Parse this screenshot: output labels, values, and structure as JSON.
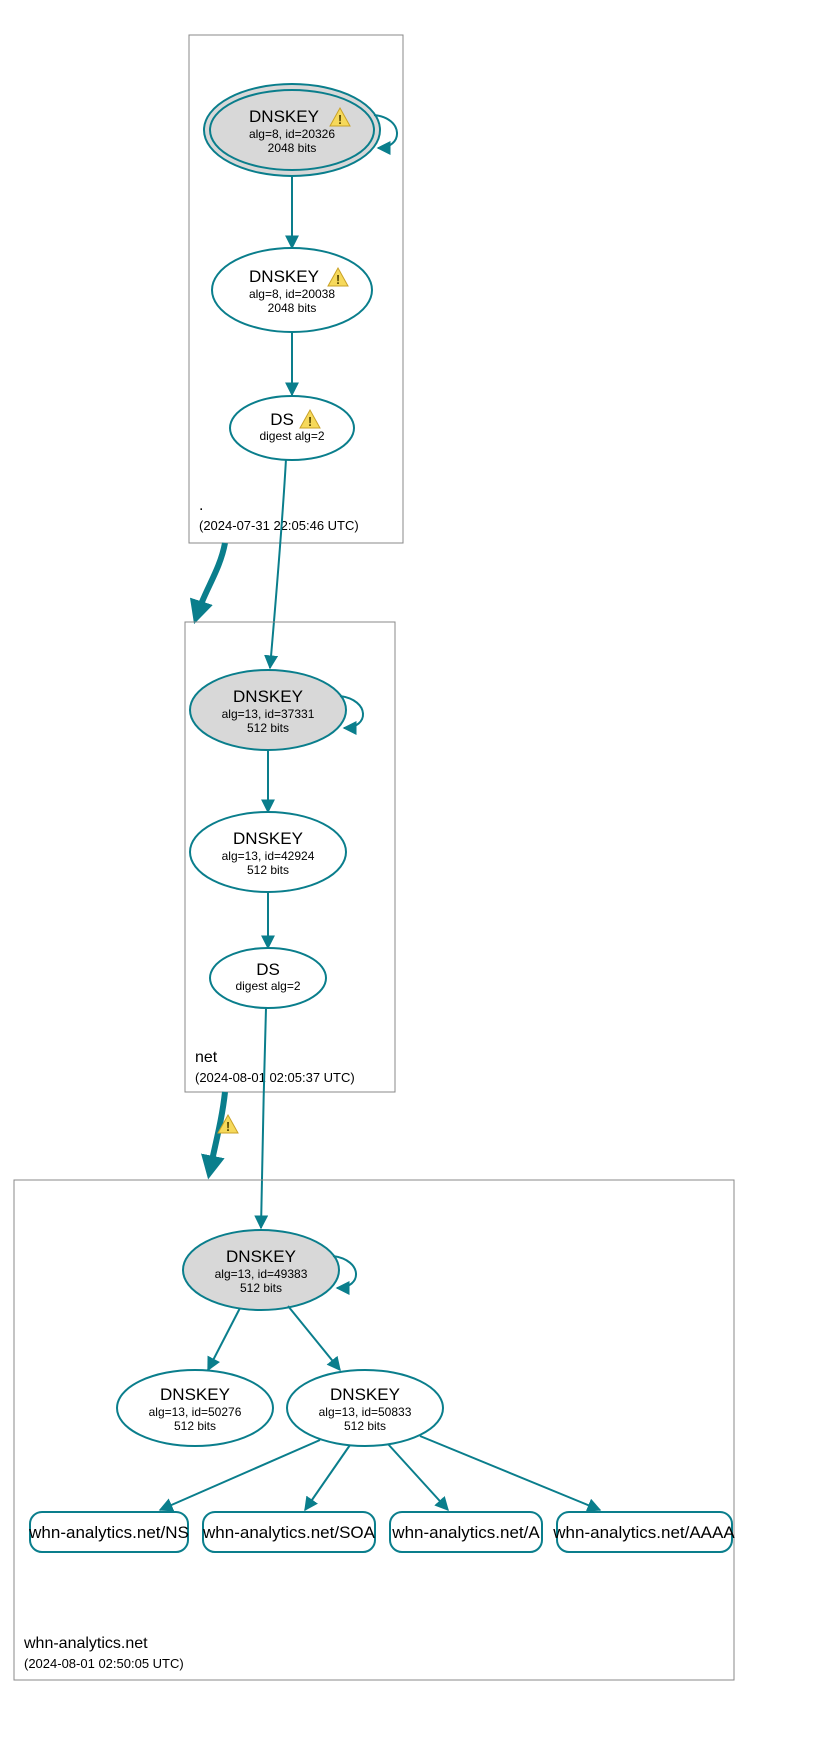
{
  "colors": {
    "stroke": "#0a7e8c",
    "ksk_fill": "#d8d8d8",
    "warn_fill": "#f6d95b",
    "warn_stroke": "#c9a227"
  },
  "zones": {
    "root": {
      "name": ".",
      "timestamp": "(2024-07-31 22:05:46 UTC)",
      "nodes": {
        "ksk": {
          "title": "DNSKEY",
          "line1": "alg=8, id=20326",
          "line2": "2048 bits",
          "warning": true
        },
        "zsk": {
          "title": "DNSKEY",
          "line1": "alg=8, id=20038",
          "line2": "2048 bits",
          "warning": true
        },
        "ds": {
          "title": "DS",
          "line1": "digest alg=2",
          "warning": true
        }
      }
    },
    "net": {
      "name": "net",
      "timestamp": "(2024-08-01 02:05:37 UTC)",
      "nodes": {
        "ksk": {
          "title": "DNSKEY",
          "line1": "alg=13, id=37331",
          "line2": "512 bits",
          "warning": false
        },
        "zsk": {
          "title": "DNSKEY",
          "line1": "alg=13, id=42924",
          "line2": "512 bits",
          "warning": false
        },
        "ds": {
          "title": "DS",
          "line1": "digest alg=2",
          "warning": false
        }
      }
    },
    "domain": {
      "name": "whn-analytics.net",
      "timestamp": "(2024-08-01 02:50:05 UTC)",
      "nodes": {
        "ksk": {
          "title": "DNSKEY",
          "line1": "alg=13, id=49383",
          "line2": "512 bits",
          "warning": false
        },
        "zskA": {
          "title": "DNSKEY",
          "line1": "alg=13, id=50276",
          "line2": "512 bits",
          "warning": false
        },
        "zskB": {
          "title": "DNSKEY",
          "line1": "alg=13, id=50833",
          "line2": "512 bits",
          "warning": false
        }
      },
      "rrsets": {
        "ns": "whn-analytics.net/NS",
        "soa": "whn-analytics.net/SOA",
        "a": "whn-analytics.net/A",
        "aaaa": "whn-analytics.net/AAAA"
      }
    }
  },
  "delegations": {
    "root_to_net_warning": false,
    "net_to_domain_warning": true
  }
}
